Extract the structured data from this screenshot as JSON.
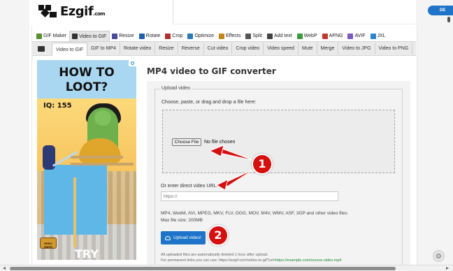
{
  "header": {
    "logo_text": "Ezgif",
    "logo_suffix": ".com",
    "corner_button": "DE"
  },
  "main_nav": [
    {
      "label": "GIF Maker",
      "icon": "gif-maker-icon",
      "color": "#5a8f2e"
    },
    {
      "label": "Video to GIF",
      "icon": "video-icon",
      "color": "#333333",
      "active": true
    },
    {
      "label": "Resize",
      "icon": "resize-icon",
      "color": "#4a4a9a"
    },
    {
      "label": "Rotate",
      "icon": "rotate-icon",
      "color": "#1f5fb0"
    },
    {
      "label": "Crop",
      "icon": "crop-icon",
      "color": "#b03030"
    },
    {
      "label": "Optimize",
      "icon": "optimize-icon",
      "color": "#2a7ab8"
    },
    {
      "label": "Effects",
      "icon": "effects-icon",
      "color": "#c2881c"
    },
    {
      "label": "Split",
      "icon": "split-icon",
      "color": "#555555"
    },
    {
      "label": "Add text",
      "icon": "add-text-icon",
      "color": "#444444"
    },
    {
      "label": "WebP",
      "icon": "webp-icon",
      "color": "#3c9a3c"
    },
    {
      "label": "APNG",
      "icon": "apng-icon",
      "color": "#c0392b"
    },
    {
      "label": "AVIF",
      "icon": "avif-icon",
      "color": "#7a5bc4"
    },
    {
      "label": "JXL",
      "icon": "jxl-icon",
      "color": "#2c84c9"
    }
  ],
  "sub_nav": [
    {
      "label": "Video to GIF",
      "active": true
    },
    {
      "label": "GIF to MP4"
    },
    {
      "label": "Rotate video"
    },
    {
      "label": "Resize"
    },
    {
      "label": "Reverse"
    },
    {
      "label": "Cut video"
    },
    {
      "label": "Crop video"
    },
    {
      "label": "Video speed"
    },
    {
      "label": "Mute"
    },
    {
      "label": "Merge"
    },
    {
      "label": "Video to JPG"
    },
    {
      "label": "Video to PNG"
    }
  ],
  "ad": {
    "title_line1": "HOW TO",
    "title_line2": "LOOT?",
    "iq": "IQ: 155",
    "cta": "TRY",
    "badge": "HERO WARS"
  },
  "main": {
    "title": "MP4 video to GIF converter",
    "legend": "Upload video",
    "choose_label": "Choose, paste, or drag and drop a file here:",
    "choose_button": "Choose File",
    "no_file": "No file chosen",
    "url_label": "Or enter direct video URL:",
    "url_placeholder": "https://",
    "formats": "MP4, WebM, AVI, MPEG, MKV, FLV, OGG, MOV, M4V, WMV, ASF, 3GP and other video files",
    "max_size": "Max file size: 200MB",
    "upload_button": "Upload video!",
    "note_deleted": "All uploaded files are automatically deleted 1 hour after upload.",
    "note_permanent_prefix": "For permanent links you can use: https://ezgif.com/video-to-gif?url=",
    "note_permanent_link": "https://example.com/source-video.mp4"
  },
  "callouts": [
    {
      "number": "1"
    },
    {
      "number": "2"
    }
  ],
  "colors": {
    "accent": "#1e74c9",
    "callout": "#d60f0f",
    "link": "#1a8a32"
  }
}
